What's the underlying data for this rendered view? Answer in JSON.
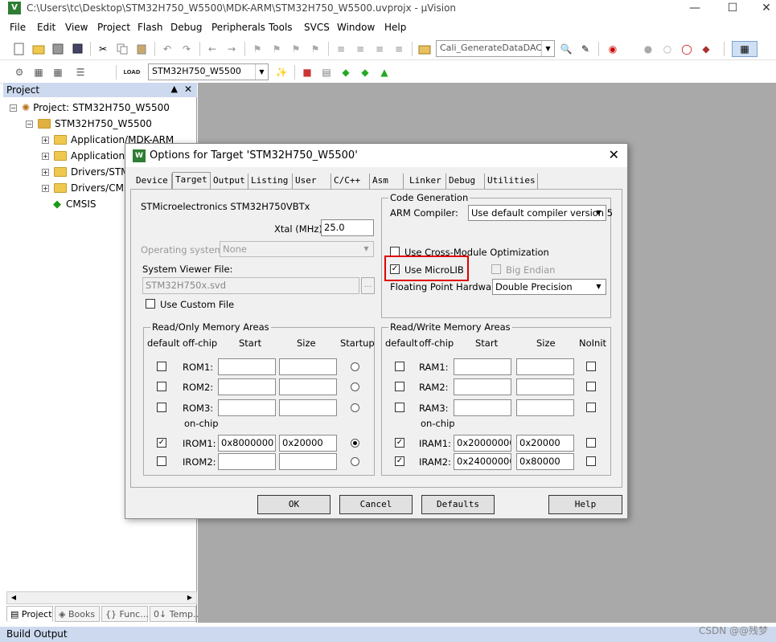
{
  "window": {
    "title": "C:\\Users\\tc\\Desktop\\STM32H750_W5500\\MDK-ARM\\STM32H750_W5500.uvprojx - µVision",
    "app_icon": "V"
  },
  "menu": [
    "File",
    "Edit",
    "View",
    "Project",
    "Flash",
    "Debug",
    "Peripherals",
    "Tools",
    "SVCS",
    "Window",
    "Help"
  ],
  "toolbar1": {
    "find_combo": "Cali_GenerateDataDAC"
  },
  "toolbar2": {
    "target_combo": "STM32H750_W5500",
    "load_label": "LOAD"
  },
  "project_pane": {
    "header": "Project",
    "root": "Project: STM32H750_W5500",
    "target": "STM32H750_W5500",
    "groups": [
      "Application/MDK-ARM",
      "Application/",
      "Drivers/STM",
      "Drivers/CMS"
    ],
    "cmsis": "CMSIS",
    "tabs": [
      "Project",
      "Books",
      "{} Func...",
      "0↓ Temp..."
    ]
  },
  "build_output": "Build Output",
  "watermark": "CSDN @@残梦",
  "dialog": {
    "title": "Options for Target 'STM32H750_W5500'",
    "icon": "W",
    "tabs": [
      "Device",
      "Target",
      "Output",
      "Listing",
      "User",
      "C/C++",
      "Asm",
      "Linker",
      "Debug",
      "Utilities"
    ],
    "device": "STMicroelectronics STM32H750VBTx",
    "xtal_label": "Xtal (MHz):",
    "xtal_value": "25.0",
    "os_label": "Operating system:",
    "os_value": "None",
    "svf_label": "System Viewer File:",
    "svf_value": "STM32H750x.svd",
    "browse": "...",
    "custom_file_label": "Use Custom File",
    "codegen": {
      "title": "Code Generation",
      "compiler_label": "ARM Compiler:",
      "compiler_value": "Use default compiler version 5",
      "cross_module_label": "Use Cross-Module Optimization",
      "microlib_label": "Use MicroLIB",
      "microlib_checked": true,
      "big_endian_label": "Big Endian",
      "fph_label": "Floating Point Hardware:",
      "fph_value": "Double Precision"
    },
    "rom": {
      "title": "Read/Only Memory Areas",
      "headers": [
        "default",
        "off-chip",
        "Start",
        "Size",
        "Startup"
      ],
      "onchip_label": "on-chip",
      "rows": [
        {
          "name": "ROM1:",
          "start": "",
          "size": "",
          "default": false,
          "startup": false
        },
        {
          "name": "ROM2:",
          "start": "",
          "size": "",
          "default": false,
          "startup": false
        },
        {
          "name": "ROM3:",
          "start": "",
          "size": "",
          "default": false,
          "startup": false
        },
        {
          "name": "IROM1:",
          "start": "0x8000000",
          "size": "0x20000",
          "default": true,
          "startup": true
        },
        {
          "name": "IROM2:",
          "start": "",
          "size": "",
          "default": false,
          "startup": false
        }
      ]
    },
    "ram": {
      "title": "Read/Write Memory Areas",
      "headers": [
        "default",
        "off-chip",
        "Start",
        "Size",
        "NoInit"
      ],
      "onchip_label": "on-chip",
      "rows": [
        {
          "name": "RAM1:",
          "start": "",
          "size": "",
          "default": false
        },
        {
          "name": "RAM2:",
          "start": "",
          "size": "",
          "default": false
        },
        {
          "name": "RAM3:",
          "start": "",
          "size": "",
          "default": false
        },
        {
          "name": "IRAM1:",
          "start": "0x20000000",
          "size": "0x20000",
          "default": true
        },
        {
          "name": "IRAM2:",
          "start": "0x24000000",
          "size": "0x80000",
          "default": true
        }
      ]
    },
    "buttons": {
      "ok": "OK",
      "cancel": "Cancel",
      "defaults": "Defaults",
      "help": "Help"
    },
    "highlight_color": "#e00000"
  }
}
